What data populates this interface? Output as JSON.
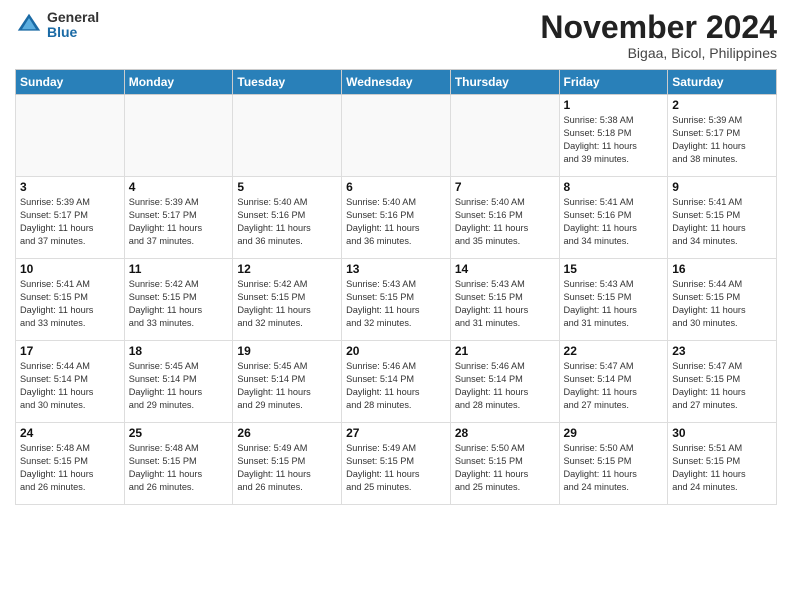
{
  "logo": {
    "general": "General",
    "blue": "Blue"
  },
  "title": "November 2024",
  "location": "Bigaa, Bicol, Philippines",
  "days_of_week": [
    "Sunday",
    "Monday",
    "Tuesday",
    "Wednesday",
    "Thursday",
    "Friday",
    "Saturday"
  ],
  "weeks": [
    [
      {
        "day": "",
        "info": ""
      },
      {
        "day": "",
        "info": ""
      },
      {
        "day": "",
        "info": ""
      },
      {
        "day": "",
        "info": ""
      },
      {
        "day": "",
        "info": ""
      },
      {
        "day": "1",
        "info": "Sunrise: 5:38 AM\nSunset: 5:18 PM\nDaylight: 11 hours\nand 39 minutes."
      },
      {
        "day": "2",
        "info": "Sunrise: 5:39 AM\nSunset: 5:17 PM\nDaylight: 11 hours\nand 38 minutes."
      }
    ],
    [
      {
        "day": "3",
        "info": "Sunrise: 5:39 AM\nSunset: 5:17 PM\nDaylight: 11 hours\nand 37 minutes."
      },
      {
        "day": "4",
        "info": "Sunrise: 5:39 AM\nSunset: 5:17 PM\nDaylight: 11 hours\nand 37 minutes."
      },
      {
        "day": "5",
        "info": "Sunrise: 5:40 AM\nSunset: 5:16 PM\nDaylight: 11 hours\nand 36 minutes."
      },
      {
        "day": "6",
        "info": "Sunrise: 5:40 AM\nSunset: 5:16 PM\nDaylight: 11 hours\nand 36 minutes."
      },
      {
        "day": "7",
        "info": "Sunrise: 5:40 AM\nSunset: 5:16 PM\nDaylight: 11 hours\nand 35 minutes."
      },
      {
        "day": "8",
        "info": "Sunrise: 5:41 AM\nSunset: 5:16 PM\nDaylight: 11 hours\nand 34 minutes."
      },
      {
        "day": "9",
        "info": "Sunrise: 5:41 AM\nSunset: 5:15 PM\nDaylight: 11 hours\nand 34 minutes."
      }
    ],
    [
      {
        "day": "10",
        "info": "Sunrise: 5:41 AM\nSunset: 5:15 PM\nDaylight: 11 hours\nand 33 minutes."
      },
      {
        "day": "11",
        "info": "Sunrise: 5:42 AM\nSunset: 5:15 PM\nDaylight: 11 hours\nand 33 minutes."
      },
      {
        "day": "12",
        "info": "Sunrise: 5:42 AM\nSunset: 5:15 PM\nDaylight: 11 hours\nand 32 minutes."
      },
      {
        "day": "13",
        "info": "Sunrise: 5:43 AM\nSunset: 5:15 PM\nDaylight: 11 hours\nand 32 minutes."
      },
      {
        "day": "14",
        "info": "Sunrise: 5:43 AM\nSunset: 5:15 PM\nDaylight: 11 hours\nand 31 minutes."
      },
      {
        "day": "15",
        "info": "Sunrise: 5:43 AM\nSunset: 5:15 PM\nDaylight: 11 hours\nand 31 minutes."
      },
      {
        "day": "16",
        "info": "Sunrise: 5:44 AM\nSunset: 5:15 PM\nDaylight: 11 hours\nand 30 minutes."
      }
    ],
    [
      {
        "day": "17",
        "info": "Sunrise: 5:44 AM\nSunset: 5:14 PM\nDaylight: 11 hours\nand 30 minutes."
      },
      {
        "day": "18",
        "info": "Sunrise: 5:45 AM\nSunset: 5:14 PM\nDaylight: 11 hours\nand 29 minutes."
      },
      {
        "day": "19",
        "info": "Sunrise: 5:45 AM\nSunset: 5:14 PM\nDaylight: 11 hours\nand 29 minutes."
      },
      {
        "day": "20",
        "info": "Sunrise: 5:46 AM\nSunset: 5:14 PM\nDaylight: 11 hours\nand 28 minutes."
      },
      {
        "day": "21",
        "info": "Sunrise: 5:46 AM\nSunset: 5:14 PM\nDaylight: 11 hours\nand 28 minutes."
      },
      {
        "day": "22",
        "info": "Sunrise: 5:47 AM\nSunset: 5:14 PM\nDaylight: 11 hours\nand 27 minutes."
      },
      {
        "day": "23",
        "info": "Sunrise: 5:47 AM\nSunset: 5:15 PM\nDaylight: 11 hours\nand 27 minutes."
      }
    ],
    [
      {
        "day": "24",
        "info": "Sunrise: 5:48 AM\nSunset: 5:15 PM\nDaylight: 11 hours\nand 26 minutes."
      },
      {
        "day": "25",
        "info": "Sunrise: 5:48 AM\nSunset: 5:15 PM\nDaylight: 11 hours\nand 26 minutes."
      },
      {
        "day": "26",
        "info": "Sunrise: 5:49 AM\nSunset: 5:15 PM\nDaylight: 11 hours\nand 26 minutes."
      },
      {
        "day": "27",
        "info": "Sunrise: 5:49 AM\nSunset: 5:15 PM\nDaylight: 11 hours\nand 25 minutes."
      },
      {
        "day": "28",
        "info": "Sunrise: 5:50 AM\nSunset: 5:15 PM\nDaylight: 11 hours\nand 25 minutes."
      },
      {
        "day": "29",
        "info": "Sunrise: 5:50 AM\nSunset: 5:15 PM\nDaylight: 11 hours\nand 24 minutes."
      },
      {
        "day": "30",
        "info": "Sunrise: 5:51 AM\nSunset: 5:15 PM\nDaylight: 11 hours\nand 24 minutes."
      }
    ]
  ]
}
